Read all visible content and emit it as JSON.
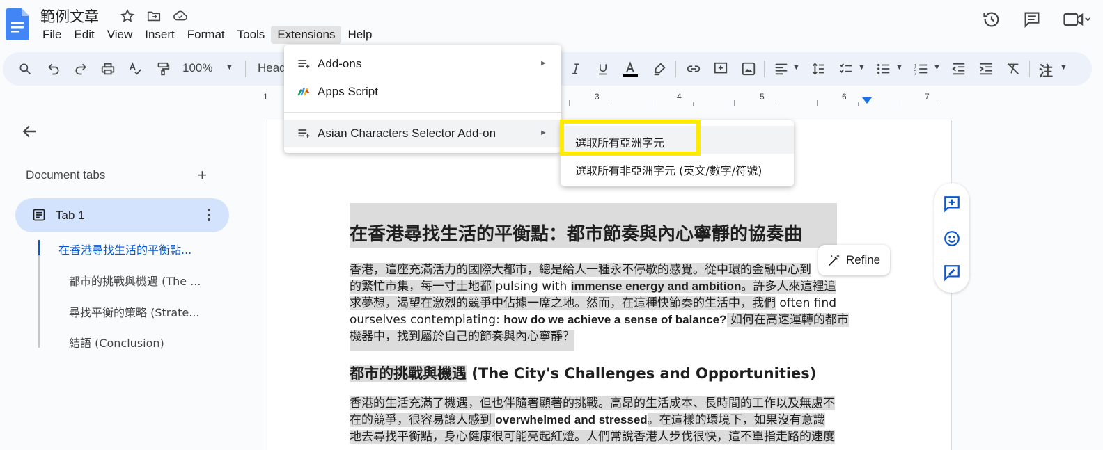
{
  "header": {
    "doc_title": "範例文章",
    "menu": [
      "File",
      "Edit",
      "View",
      "Insert",
      "Format",
      "Tools",
      "Extensions",
      "Help"
    ],
    "active_menu_index": 6
  },
  "toolbar": {
    "zoom": "100%",
    "style": "Head",
    "input_tool": "注"
  },
  "ruler": {
    "numbers": [
      "1",
      "3",
      "4",
      "5",
      "6",
      "7"
    ]
  },
  "sidebar": {
    "tabs_title": "Document tabs",
    "add_icon_text": "+",
    "tab_label": "Tab 1",
    "outline": [
      "在香港尋找生活的平衡點...",
      "都市的挑戰與機遇 (The ...",
      "尋找平衡的策略 (Strate...",
      "結語 (Conclusion)"
    ]
  },
  "extensions_menu": {
    "items": [
      {
        "label": "Add-ons",
        "has_submenu": true
      },
      {
        "label": "Apps Script",
        "has_submenu": false
      },
      {
        "label": "Asian Characters Selector Add-on",
        "has_submenu": true
      }
    ],
    "submenu_arrow": "►"
  },
  "submenu": {
    "items": [
      "選取所有亞洲字元",
      "選取所有非亞洲字元 (英文/數字/符號)"
    ]
  },
  "document": {
    "title": "在香港尋找生活的平衡點：都市節奏與內心寧靜的協奏曲",
    "p1": {
      "a": "香港，這座充滿活力的國際大都市，總是給人一種永不停歇的感覺。從中環的金融中心到",
      "b": "的繁忙市集，每一寸土地都 ",
      "c": "pulsing with ",
      "d": "immense energy and ambition",
      "e": "。許多人來這裡追",
      "f": "求夢想，渴望在激烈的競爭中佔據一席之地。然而，在這種快節奏的生活中，我們",
      "g": " often find",
      "h": "ourselves contemplating: ",
      "i": "how do we achieve a sense of balance?",
      "j": " 如何在高速運轉的都市",
      "k": "機器中，找到屬於自己的節奏與內心寧靜？"
    },
    "h2_cjk": "都市的挑戰與機遇",
    "h2_en": " (The City's Challenges and Opportunities)",
    "p2": {
      "a": "香港的生活充滿了機遇，但也伴隨著顯著的挑戰。高昂的生活成本、長時間的工作以及無處不",
      "b": "在的競爭，很容易讓人感到 ",
      "c": "overwhelmed and stressed",
      "d": "。在這樣的環境下，如果沒有意識",
      "e": "地去尋找平衡點，身心健康很可能亮起紅燈。人們常說香港人步伐很快，這不單指走路的速度"
    }
  },
  "refine_chip": {
    "label": "Refine"
  },
  "colors": {
    "accent": "#0b57d0",
    "highlight_box": "#ffeb00",
    "tab_selected": "#d3e3fd"
  }
}
